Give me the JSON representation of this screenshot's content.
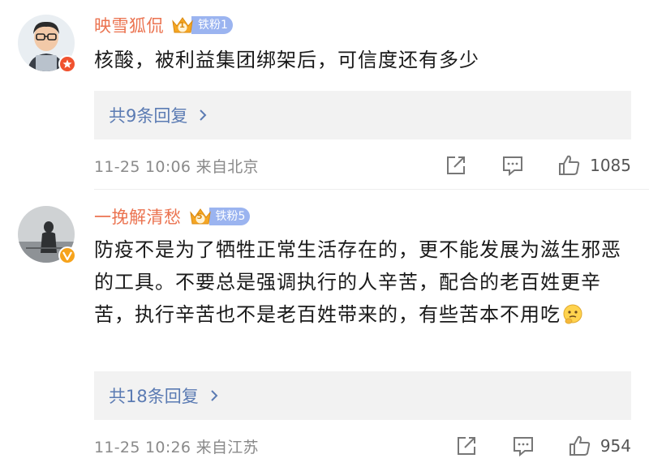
{
  "comments": [
    {
      "username": "映雪狐侃",
      "fan_badge": {
        "level": "1",
        "label": "铁粉1"
      },
      "text": "核酸，被利益集团绑架后，可信度还有多少",
      "replies_label": "共9条回复",
      "meta": "11-25 10:06 来自北京",
      "likes": "1085"
    },
    {
      "username": "一挽解清愁",
      "fan_badge": {
        "level": "5",
        "label": "铁粉5"
      },
      "text": "防疫不是为了牺牲正常生活存在的，更不能发展为滋生邪恶的工具。不要总是强调执行的人辛苦，配合的老百姓更辛苦，执行辛苦也不是老百姓带来的，有些苦本不用吃",
      "replies_label": "共18条回复",
      "meta": "11-25 10:26 来自江苏",
      "likes": "954"
    }
  ],
  "icons": {
    "share": "share-icon",
    "comment": "comment-icon",
    "like": "like-icon",
    "emoji": "thinking-emoji-icon"
  },
  "colors": {
    "username": "#eb7350",
    "reply_link": "#5b7bb3",
    "fan_badge": "#9bb4f0",
    "meta": "#8a8a8a"
  }
}
